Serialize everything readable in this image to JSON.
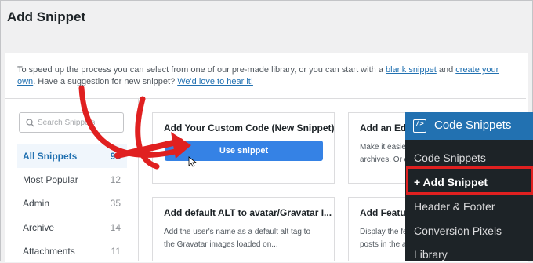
{
  "page": {
    "title": "Add Snippet"
  },
  "intro": {
    "text_before": "To speed up the process you can select from one of our pre-made library, or you can start with a ",
    "blank_snippet_link": "blank snippet",
    "text_and": " and ",
    "create_link": "create your own",
    "text_after": ". Have a suggestion for new snippet? ",
    "love_link": "We'd love to hear it!"
  },
  "search": {
    "placeholder": "Search Snippets",
    "icon": "search-icon"
  },
  "categories": [
    {
      "label": "All Snippets",
      "count": "95",
      "active": true
    },
    {
      "label": "Most Popular",
      "count": "12"
    },
    {
      "label": "Admin",
      "count": "35"
    },
    {
      "label": "Archive",
      "count": "14"
    },
    {
      "label": "Attachments",
      "count": "11"
    }
  ],
  "snippets": [
    {
      "title": "Add Your Custom Code (New Snippet)",
      "button": "Use snippet"
    },
    {
      "title": "Add an Edi",
      "desc_lines": [
        "Make it easie",
        "archives. Or c"
      ]
    },
    {
      "title": "Add default ALT to avatar/Gravatar I...",
      "desc_lines": [
        "Add the user's name as a default alt tag to",
        "the Gravatar images loaded on..."
      ]
    },
    {
      "title": "Add Featur",
      "desc_lines": [
        "Display the fe",
        "posts in the a"
      ]
    }
  ],
  "wp_menu": {
    "header": "Code Snippets",
    "logo_glyph": "/>",
    "items": [
      "Code Snippets",
      "+ Add Snippet",
      "Header & Footer",
      "Conversion Pixels",
      "Library"
    ],
    "current_index": 1
  },
  "colors": {
    "accent": "#2271b1",
    "button": "#3582e5",
    "annotation": "#e02020",
    "menu_bg": "#1d2327"
  }
}
